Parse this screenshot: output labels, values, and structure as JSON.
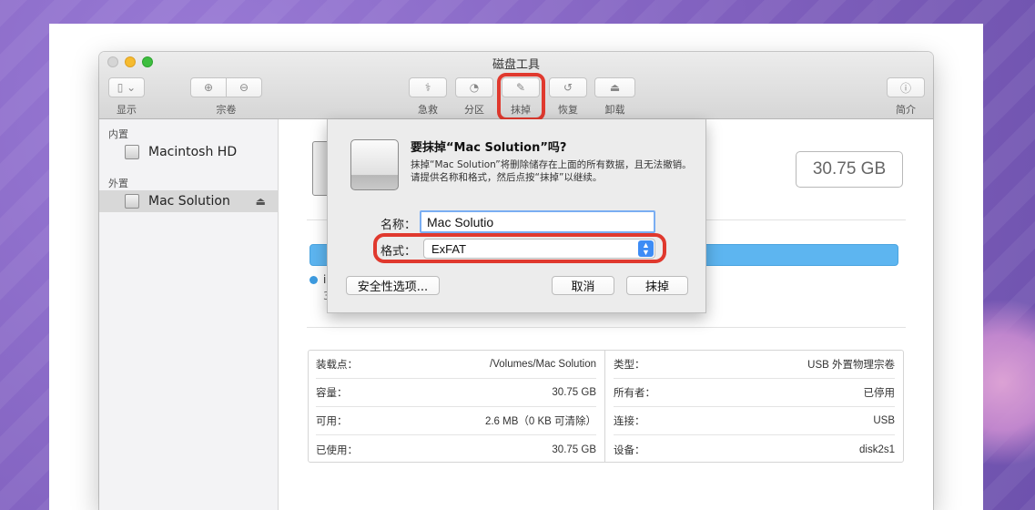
{
  "window": {
    "title": "磁盘工具"
  },
  "toolbar": {
    "view_label": "显示",
    "volume_label": "宗卷",
    "first_aid_label": "急救",
    "partition_label": "分区",
    "erase_label": "抹掉",
    "restore_label": "恢复",
    "unmount_label": "卸载",
    "info_label": "简介"
  },
  "sidebar": {
    "internal_header": "内置",
    "external_header": "外置",
    "items": [
      {
        "label": "Macintosh HD"
      },
      {
        "label": "Mac Solution"
      }
    ]
  },
  "content": {
    "capacity": "30.75 GB",
    "info_rows_left": [
      {
        "label": "装载点：",
        "value": "/Volumes/Mac Solution"
      },
      {
        "label": "容量：",
        "value": "30.75 GB"
      },
      {
        "label": "可用：",
        "value": "2.6 MB（0 KB 可清除）"
      },
      {
        "label": "已使用：",
        "value": "30.75 GB"
      }
    ],
    "info_rows_right": [
      {
        "label": "类型：",
        "value": "USB 外置物理宗卷"
      },
      {
        "label": "所有者：",
        "value": "已停用"
      },
      {
        "label": "连接：",
        "value": "USB"
      },
      {
        "label": "设备：",
        "value": "disk2s1"
      }
    ],
    "legend_partial": "i",
    "legend_sub_partial": "3"
  },
  "erase_dialog": {
    "title": "要抹掉“Mac Solution”吗?",
    "description": "抹掉“Mac Solution”将删除储存在上面的所有数据，且无法撤销。请提供名称和格式，然后点按“抹掉”以继续。",
    "name_label": "名称：",
    "name_value": "Mac Solutio",
    "format_label": "格式：",
    "format_value": "ExFAT",
    "security_button": "安全性选项...",
    "cancel_button": "取消",
    "erase_button": "抹掉"
  },
  "colors": {
    "highlight": "#e0392e",
    "usage_bar": "#5db5f0",
    "select_accent": "#3d8cf5"
  }
}
